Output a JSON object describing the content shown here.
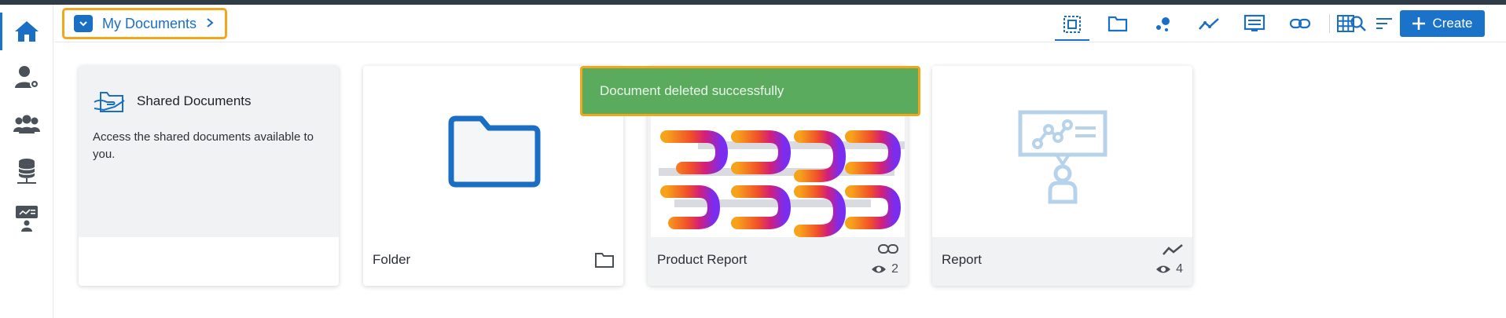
{
  "breadcrumb": {
    "label": "My Documents"
  },
  "toolbar": {
    "items": [
      {
        "name": "select-all-icon"
      },
      {
        "name": "folder-icon"
      },
      {
        "name": "bubble-chart-icon"
      },
      {
        "name": "trend-line-icon"
      },
      {
        "name": "presentation-icon"
      },
      {
        "name": "link-icon"
      },
      {
        "name": "grid-icon"
      }
    ],
    "create_label": "Create"
  },
  "sidebar": {
    "items": [
      {
        "name": "home-icon",
        "active": true
      },
      {
        "name": "user-settings-icon"
      },
      {
        "name": "group-icon"
      },
      {
        "name": "database-icon"
      },
      {
        "name": "presenter-icon"
      }
    ]
  },
  "toast": {
    "message": "Document deleted successfully"
  },
  "cards": {
    "shared": {
      "title": "Shared Documents",
      "description": "Access the shared documents available to you."
    },
    "folder": {
      "title": "Folder"
    },
    "product_report": {
      "title": "Product Report",
      "views": "2"
    },
    "report": {
      "title": "Report",
      "views": "4"
    }
  },
  "colors": {
    "accent": "#1a73c9",
    "toast": "#5aab5e",
    "highlight": "#f2a71b"
  }
}
